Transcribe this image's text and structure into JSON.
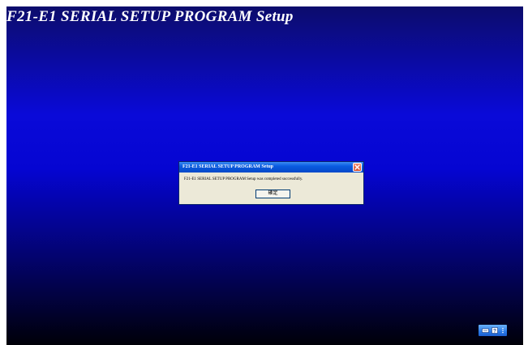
{
  "background": {
    "title": "F21-E1  SERIAL SETUP PROGRAM Setup"
  },
  "dialog": {
    "title": "F21-E1  SERIAL SETUP PROGRAM Setup",
    "message": "F21-E1  SERIAL SETUP PROGRAM Setup was completed successfully.",
    "ok_label": "確定",
    "close_icon": "close-icon"
  },
  "tray": {
    "icons": [
      "keyboard-icon",
      "help-icon",
      "options-icon"
    ]
  },
  "colors": {
    "background_top": "#0c0c6c",
    "background_mid": "#0505d2",
    "background_bottom": "#000008",
    "titlebar": "#0a5be0",
    "close_button": "#d24a2a",
    "dialog_body": "#ece9d8"
  }
}
